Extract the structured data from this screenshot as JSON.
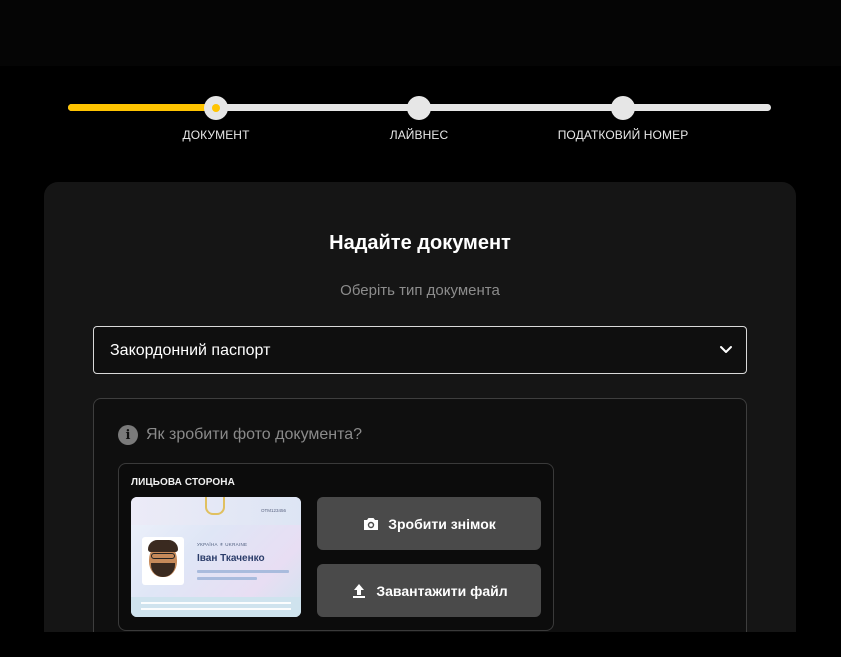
{
  "stepper": {
    "progress": 0.21,
    "steps": [
      {
        "label": "ДОКУМЕНТ",
        "state": "active"
      },
      {
        "label": "ЛАЙВНЕС",
        "state": "pending"
      },
      {
        "label": "ПОДАТКОВИЙ НОМЕР",
        "state": "pending"
      }
    ],
    "colors": {
      "accent": "#ffc400",
      "track": "#e6e6e6"
    }
  },
  "card": {
    "title": "Надайте документ",
    "subtitle": "Оберіть тип документа"
  },
  "document_select": {
    "value": "Закордонний паспорт",
    "icon": "chevron-down-icon"
  },
  "photo_guide": {
    "hint": "Як зробити фото документа?",
    "hint_icon": "info-icon",
    "side": {
      "label": "ЛИЦЬОВА СТОРОНА",
      "sample": {
        "country": "УКРАЇНА  ⚜  UKRAINE",
        "name": "Іван Ткаченко",
        "number": "ОТМ123456"
      }
    },
    "buttons": {
      "take_photo": {
        "label": "Зробити знімок",
        "icon": "camera-icon"
      },
      "upload_file": {
        "label": "Завантажити файл",
        "icon": "upload-icon"
      }
    }
  }
}
